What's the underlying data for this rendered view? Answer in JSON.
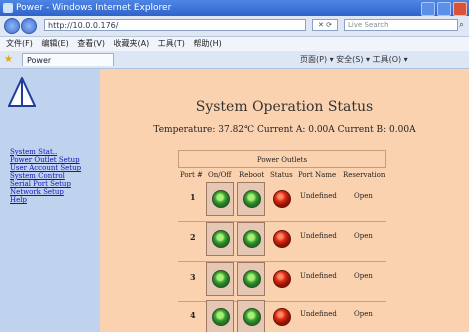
{
  "window": {
    "title": "Power - Windows Internet Explorer"
  },
  "address_bar": {
    "url": "http://10.0.0.176/"
  },
  "search": {
    "placeholder": "Live Search"
  },
  "menubar": {
    "items": [
      "文件(F)",
      "编辑(E)",
      "查看(V)",
      "收藏夹(A)",
      "工具(T)",
      "帮助(H)"
    ]
  },
  "tab": {
    "label": "Power"
  },
  "toolbar": {
    "tools_text": "页面(P) ▾  安全(S) ▾  工具(O) ▾"
  },
  "sidebar": {
    "links": [
      "System Stat..",
      "Power Outlet Setup",
      "User Account Setup",
      "System Control",
      "Serial Port Setup",
      "Network Setup",
      "Help"
    ]
  },
  "page": {
    "title": "System Operation Status",
    "readings": "Temperature: 37.82℃  Current A: 0.00A  Current B: 0.00A"
  },
  "panel": {
    "heading": "Power Outlets",
    "columns": [
      "Port #",
      "On/Off",
      "Reboot",
      "Status",
      "Port Name",
      "Reservation"
    ],
    "rows": [
      {
        "port": "1",
        "name": "Undefined",
        "reservation": "Open"
      },
      {
        "port": "2",
        "name": "Undefined",
        "reservation": "Open"
      },
      {
        "port": "3",
        "name": "Undefined",
        "reservation": "Open"
      },
      {
        "port": "4",
        "name": "Undefined",
        "reservation": "Open"
      }
    ]
  },
  "colors": {
    "content_bg": "#fbd2b0",
    "sidebar_bg": "#bfd3ee",
    "link": "#1515b9",
    "status_led": "#df2a12",
    "switch_green": "#3fa235"
  }
}
